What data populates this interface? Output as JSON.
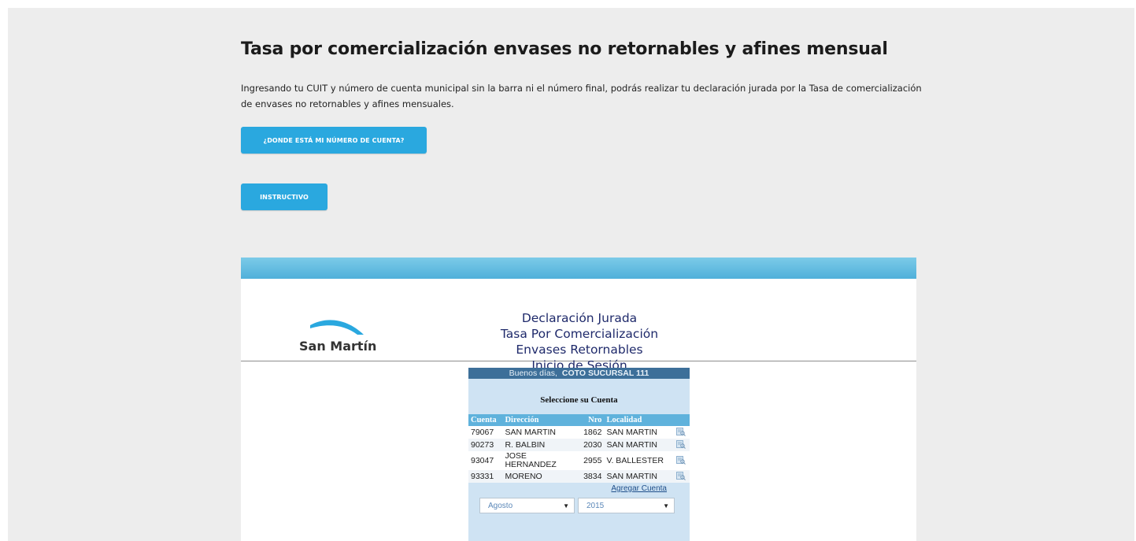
{
  "page": {
    "title": "Tasa por comercialización envases no retornables y afines mensual",
    "intro": "Ingresando tu CUIT y número de cuenta municipal sin la barra ni el número final, podrás realizar tu declaración jurada por la Tasa de comercialización de envases no retornables y afines mensuales.",
    "buttons": {
      "cuenta_label": "¿DONDE ESTÁ MI NÚMERO DE CUENTA?",
      "instructivo_label": "INSTRUCTIVO"
    }
  },
  "embed": {
    "logo_text": "San Martín",
    "header_lines": [
      "Declaración Jurada",
      "Tasa Por Comercialización",
      "Envases Retornables",
      "Inicio de Sesión"
    ],
    "greeting": "Buenos días,",
    "user": "COTO SUCURSAL 111",
    "select_title": "Seleccione su Cuenta",
    "columns": [
      "Cuenta",
      "Dirección",
      "Nro",
      "Localidad"
    ],
    "rows": [
      {
        "cuenta": "79067",
        "direccion": "SAN MARTIN",
        "nro": "1862",
        "localidad": "SAN MARTIN",
        "icon": "view-account-icon"
      },
      {
        "cuenta": "90273",
        "direccion": "R. BALBIN",
        "nro": "2030",
        "localidad": "SAN MARTIN",
        "icon": "view-account-icon"
      },
      {
        "cuenta": "93047",
        "direccion": "JOSE HERNANDEZ",
        "nro": "2955",
        "localidad": "V. BALLESTER",
        "icon": "view-account-icon"
      },
      {
        "cuenta": "93331",
        "direccion": "MORENO",
        "nro": "3834",
        "localidad": "SAN MARTIN",
        "icon": "view-account-icon"
      }
    ],
    "add_account": "Agregar Cuenta",
    "month_selected": "Agosto",
    "year_selected": "2015"
  },
  "colors": {
    "button": "#2aa8df",
    "greeting_bar": "#3d6f99",
    "table_header": "#5fb2dc",
    "panel": "#cfe3f3",
    "heading_text": "#1f2a6b"
  }
}
